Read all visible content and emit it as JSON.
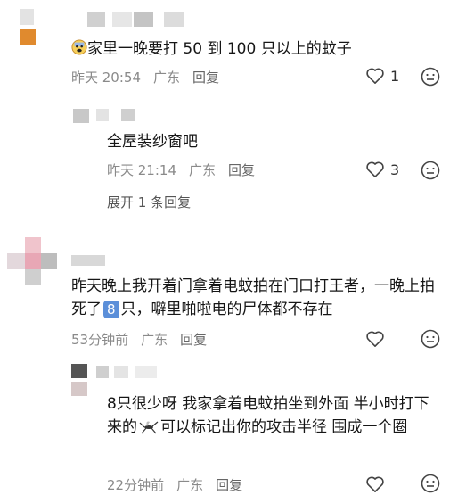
{
  "comments": [
    {
      "text_prefix_emoji": "scared-face-emoji",
      "text": "家里一晚要打 50 到 100 只以上的蚊子",
      "time": "昨天 20:54",
      "location": "广东",
      "reply_label": "回复",
      "likes": "1",
      "replies": [
        {
          "text": "全屋装纱窗吧",
          "time": "昨天 21:14",
          "location": "广东",
          "reply_label": "回复",
          "likes": "3"
        }
      ],
      "expand_label": "展开 1 条回复"
    },
    {
      "text_part1": "昨天晚上我开着门拿着电蚊拍在门口打王者，一晚上拍死了",
      "badge": "8",
      "text_part2": "只，噼里啪啦电的尸体都不存在",
      "time": "53分钟前",
      "location": "广东",
      "reply_label": "回复",
      "likes": "",
      "replies": [
        {
          "text_part1": "8只很少呀   我家拿着电蚊拍坐到外面  半小时打下来的",
          "text_part2": "可以标记出你的攻击半径  围成一个圈",
          "inline_emoji": "mosquito-emoji",
          "time": "22分钟前",
          "location": "广东",
          "reply_label": "回复",
          "likes": ""
        }
      ]
    }
  ],
  "colors": {
    "meta_gray": "#8a8a8a",
    "badge_blue": "#5b8fd9",
    "avatar_orange": "#e08a2e",
    "avatar_pink": "#e8b4c0"
  }
}
